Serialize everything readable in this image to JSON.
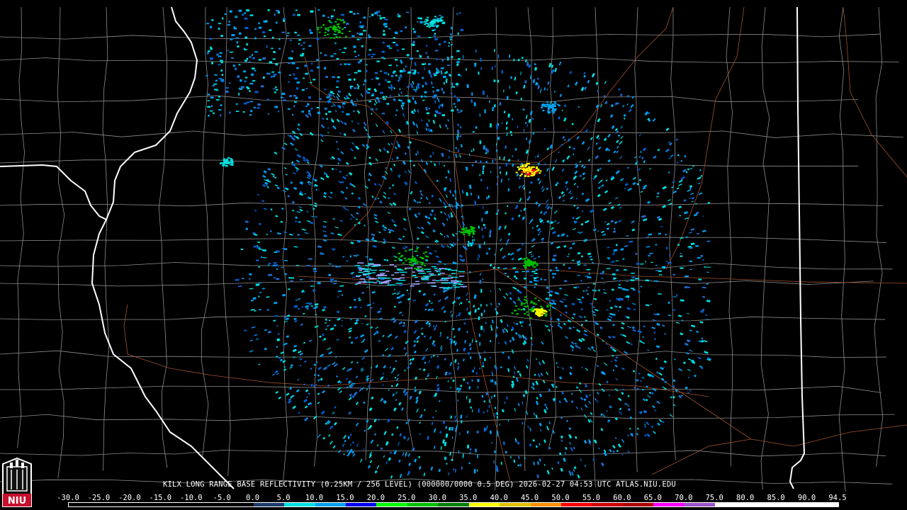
{
  "caption": {
    "text": "KILX LONG RANGE BASE REFLECTIVITY (0.25KM / 256 LEVEL) (000000/0000 0.5 DEG) 2026-02-27 04:53 UTC  ATLAS.NIU.EDU"
  },
  "logo": {
    "label": "NIU"
  },
  "colorscale": {
    "labels": [
      "-30.0",
      "-25.0",
      "-20.0",
      "-15.0",
      "-10.0",
      "-5.0",
      "0.0",
      "5.0",
      "10.0",
      "15.0",
      "20.0",
      "25.0",
      "30.0",
      "35.0",
      "40.0",
      "45.0",
      "50.0",
      "55.0",
      "60.0",
      "65.0",
      "70.0",
      "75.0",
      "80.0",
      "85.0",
      "90.0",
      "94.5"
    ],
    "colors": [
      "#000000",
      "#000000",
      "#000000",
      "#000000",
      "#000000",
      "#000000",
      "#1c3c6c",
      "#00e0e0",
      "#00a0f0",
      "#0000f0",
      "#00ff00",
      "#00c000",
      "#008000",
      "#ffff00",
      "#e0c000",
      "#ff9000",
      "#ff0000",
      "#d00000",
      "#b00000",
      "#ff00ff",
      "#9a55c9",
      "#ffffff",
      "#ffffff",
      "#ffffff",
      "#ffffff"
    ]
  },
  "colors": {
    "state_border": "#ffffff",
    "county_border": "#8c8c8c",
    "roads": "#a0522d",
    "background": "#000000"
  }
}
